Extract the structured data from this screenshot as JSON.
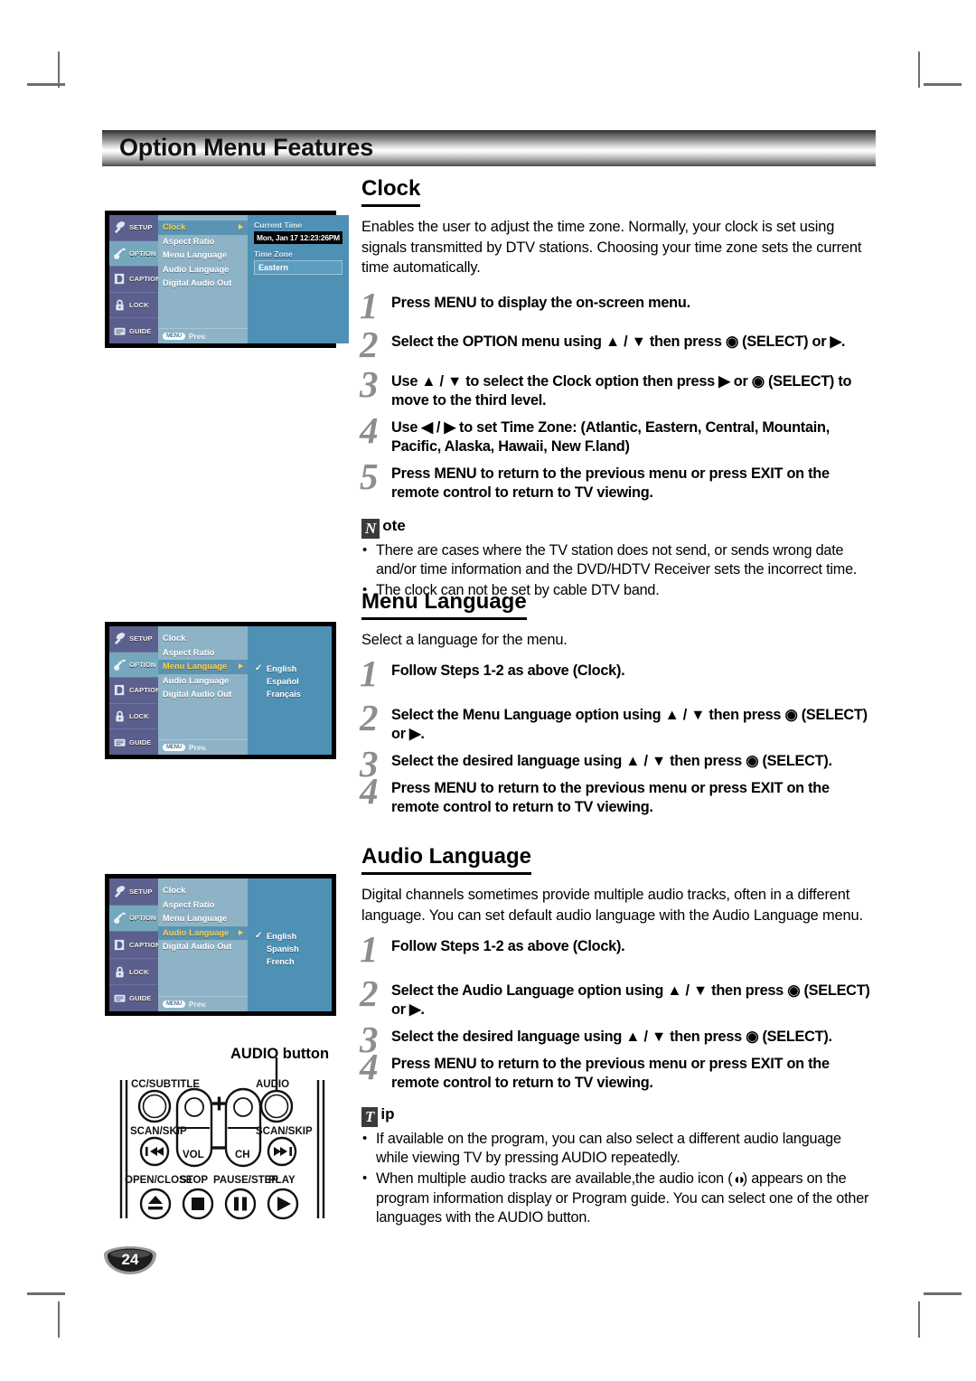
{
  "page": {
    "header_title": "Option Menu Features",
    "page_number": "24"
  },
  "sections": {
    "clock": {
      "heading": "Clock",
      "intro": "Enables the user to adjust the time zone.  Normally, your clock is set using signals transmitted by DTV stations. Choosing your time zone sets the current time automatically.",
      "steps": [
        {
          "num": "1",
          "text": "Press MENU to display the on-screen menu."
        },
        {
          "num": "2",
          "text": "Select the OPTION menu using ▲ / ▼ then press ◉ (SELECT) or ▶."
        },
        {
          "num": "3",
          "text": "Use ▲ / ▼ to select the Clock option then press ▶ or ◉ (SELECT) to move to the third level."
        },
        {
          "num": "4",
          "text": "Use ◀ / ▶ to set Time Zone: (Atlantic, Eastern, Central, Mountain, Pacific, Alaska, Hawaii, New F.land)"
        },
        {
          "num": "5",
          "text": "Press MENU to return to the previous menu or press EXIT on the remote control to return to TV viewing."
        }
      ],
      "note": {
        "glyph": "N",
        "label": "ote",
        "items": [
          "There are cases where the TV station does not send, or sends wrong date and/or time information and the DVD/HDTV Receiver sets the incorrect time.",
          "The clock can not be set by cable DTV band."
        ]
      }
    },
    "menu_language": {
      "heading": "Menu Language",
      "intro": "Select a language for the menu.",
      "steps": [
        {
          "num": "1",
          "text": "Follow Steps 1-2 as above (Clock)."
        },
        {
          "num": "2",
          "text": "Select the Menu Language option using ▲ / ▼ then press ◉ (SELECT) or ▶."
        },
        {
          "num": "3",
          "text": "Select the desired language using ▲ / ▼  then press ◉ (SELECT)."
        },
        {
          "num": "4",
          "text": "Press MENU to return to the previous menu or press EXIT on the remote control to return to TV viewing."
        }
      ]
    },
    "audio_language": {
      "heading": "Audio Language",
      "intro": "Digital channels sometimes provide multiple audio tracks, often in a different language. You can set default audio language with the Audio Language menu.",
      "steps": [
        {
          "num": "1",
          "text": "Follow Steps 1-2 as above (Clock)."
        },
        {
          "num": "2",
          "text": "Select the Audio Language option using ▲ / ▼ then press ◉ (SELECT) or ▶."
        },
        {
          "num": "3",
          "text": "Select the desired language using ▲ / ▼  then press ◉ (SELECT)."
        },
        {
          "num": "4",
          "text": "Press MENU to return to the previous menu or press EXIT on the remote control to return to TV viewing."
        }
      ],
      "tip": {
        "glyph": "T",
        "label": "ip",
        "items": [
          "If available on the program, you can also select a different audio language while viewing TV by pressing AUDIO repeatedly.",
          "When multiple audio tracks are available,the audio icon (\u0001) appears on the program information display or Program guide. You can select one of the other languages with the AUDIO button."
        ],
        "item2_part1": "When multiple audio tracks are available,the audio icon (",
        "item2_part2": ") appears on the program information display or Program guide. You can select one of the other languages with the AUDIO button."
      }
    }
  },
  "osd": {
    "sidebar": [
      {
        "label": "SETUP",
        "icon": "satellite-dish-icon",
        "selected": false
      },
      {
        "label": "OPTION",
        "icon": "key-icon",
        "selected": true
      },
      {
        "label": "CAPTION",
        "icon": "caption-icon",
        "selected": false
      },
      {
        "label": "LOCK",
        "icon": "padlock-icon",
        "selected": false
      },
      {
        "label": "GUIDE",
        "icon": "guide-book-icon",
        "selected": false
      }
    ],
    "menu_items": [
      "Clock",
      "Aspect Ratio",
      "Menu Language",
      "Audio Language",
      "Digital Audio Out"
    ],
    "prev_pill": "MENU",
    "prev_label": "Prev.",
    "clock_panel": {
      "selected_item": "Clock",
      "current_time_label": "Current Time",
      "current_time_value": "Mon, Jan 17  12:23:26PM",
      "time_zone_label": "Time Zone",
      "time_zone_value": "Eastern"
    },
    "menu_language_panel": {
      "selected_item": "Menu Language",
      "options": [
        {
          "label": "English",
          "checked": true
        },
        {
          "label": "Español",
          "checked": false
        },
        {
          "label": "Français",
          "checked": false
        }
      ]
    },
    "audio_language_panel": {
      "selected_item": "Audio Language",
      "options": [
        {
          "label": "English",
          "checked": true
        },
        {
          "label": "Spanish",
          "checked": false
        },
        {
          "label": "French",
          "checked": false
        }
      ]
    }
  },
  "remote": {
    "caption": "AUDIO button",
    "buttons": [
      "CC/SUBTITLE",
      "AUDIO",
      "SCAN/SKIP",
      "SCAN/SKIP",
      "VOL",
      "CH",
      "OPEN/CLOSE",
      "STOP",
      "PAUSE/STEP",
      "PLAY"
    ],
    "plus": "+",
    "minus": "–"
  },
  "colors": {
    "osd_sidebar": "#5d6190",
    "osd_sidebar_selected": "#76a8bd",
    "osd_menu_bg": "#8fb3c6",
    "osd_menu_selected": "#5b93b2",
    "osd_highlight_text": "#ffd24a",
    "osd_panel": "#4f90b5"
  }
}
